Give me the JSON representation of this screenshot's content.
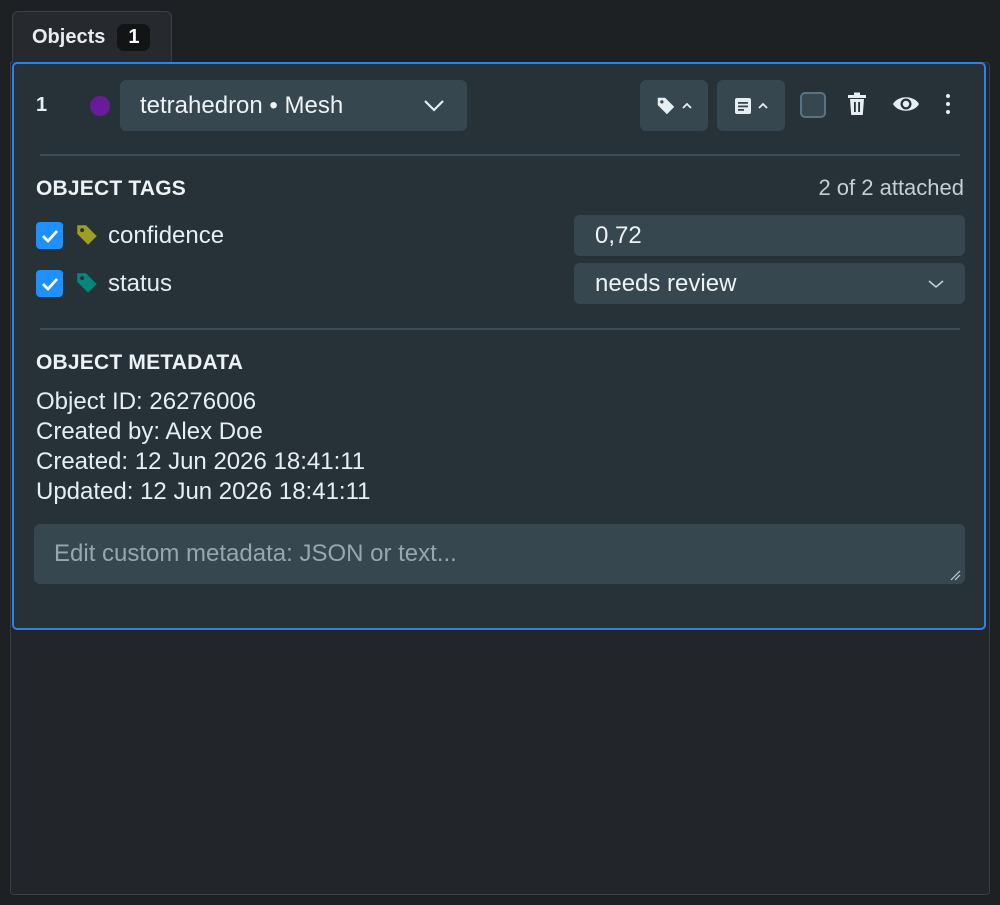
{
  "tab": {
    "label": "Objects",
    "count": "1"
  },
  "object": {
    "index": "1",
    "color": "#6a1b9a",
    "type_label": "tetrahedron • Mesh"
  },
  "toolbar": {
    "tag_icon": "tag-icon",
    "notes_icon": "notes-icon",
    "delete_icon": "trash-icon",
    "visibility_icon": "eye-icon",
    "more_icon": "more-vertical-icon"
  },
  "tags_section": {
    "title": "OBJECT TAGS",
    "attached_text": "2 of 2 attached",
    "tags": [
      {
        "name": "confidence",
        "checked": true,
        "color": "#9e9d24",
        "value": "0,72"
      },
      {
        "name": "status",
        "checked": true,
        "color": "#00897b",
        "value": "needs review"
      }
    ]
  },
  "metadata_section": {
    "title": "OBJECT METADATA",
    "lines": [
      "Object ID: 26276006",
      "Created by: Alex Doe",
      "Created: 12 Jun 2026 18:41:11",
      "Updated: 12 Jun 2026 18:41:11"
    ],
    "custom_placeholder": "Edit custom metadata: JSON or text..."
  },
  "colors": {
    "accent": "#2f80ed",
    "checkbox": "#1e90ff"
  }
}
